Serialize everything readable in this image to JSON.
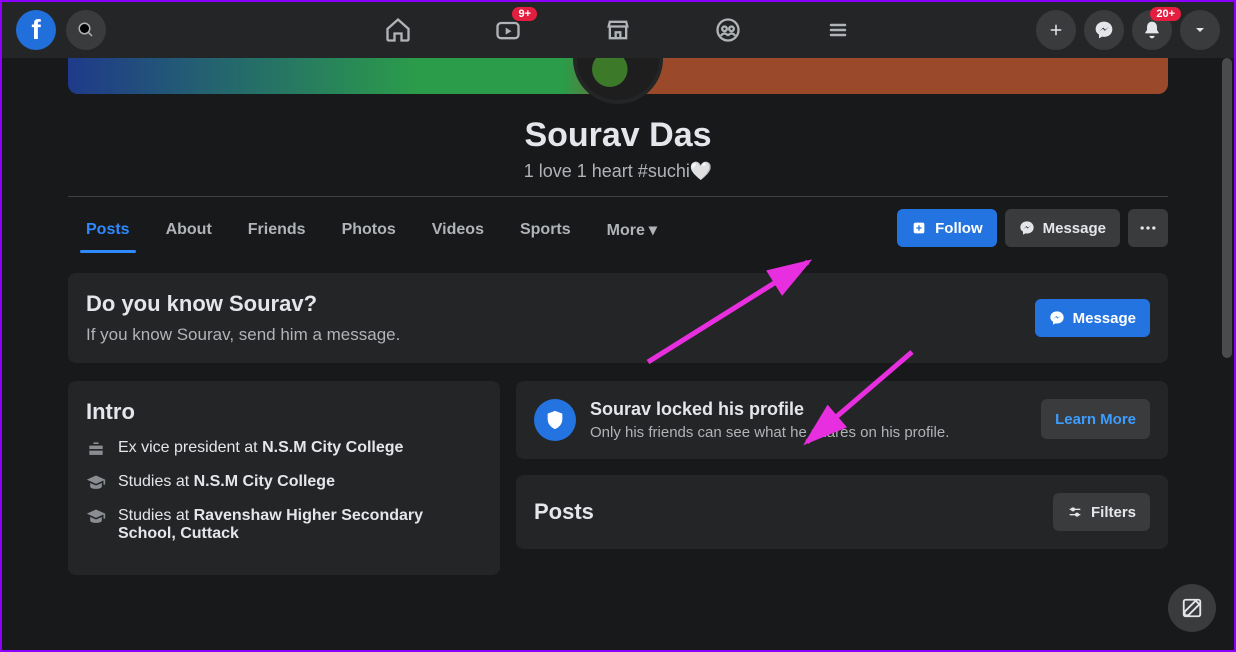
{
  "nav": {
    "watch_badge": "9+",
    "notif_badge": "20+"
  },
  "profile": {
    "name": "Sourav Das",
    "bio": "1 love 1 heart #suchi🤍"
  },
  "tabs": [
    "Posts",
    "About",
    "Friends",
    "Photos",
    "Videos",
    "Sports",
    "More"
  ],
  "actions": {
    "follow_label": "Follow",
    "message_label": "Message"
  },
  "prompt": {
    "title": "Do you know Sourav?",
    "subtitle": "If you know Sourav, send him a message.",
    "button": "Message"
  },
  "intro": {
    "title": "Intro",
    "items": [
      {
        "prefix": "Ex vice president at ",
        "bold": "N.S.M City College"
      },
      {
        "prefix": "Studies at ",
        "bold": "N.S.M City College"
      },
      {
        "prefix": "Studies at ",
        "bold": "Ravenshaw Higher Secondary School, Cuttack"
      }
    ]
  },
  "locked": {
    "title": "Sourav locked his profile",
    "subtitle": "Only his friends can see what he shares on his profile.",
    "button": "Learn More"
  },
  "posts": {
    "title": "Posts",
    "filters": "Filters"
  },
  "colors": {
    "accent": "#2374e1",
    "bg": "#18191a",
    "card": "#242526",
    "pink": "#d326e0"
  }
}
